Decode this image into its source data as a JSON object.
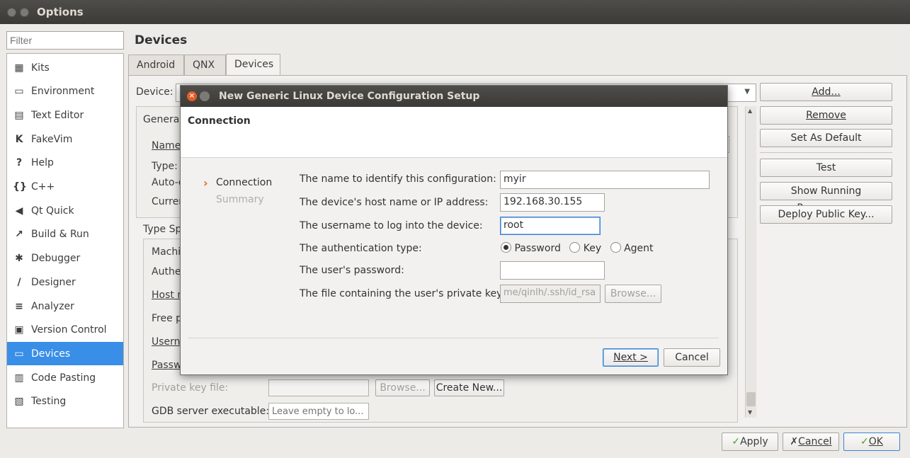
{
  "window": {
    "title": "Options"
  },
  "filter": {
    "placeholder": "Filter"
  },
  "nav": [
    {
      "label": "Kits",
      "icon": "monitor-icon"
    },
    {
      "label": "Environment",
      "icon": "display-icon"
    },
    {
      "label": "Text Editor",
      "icon": "text-editor-icon"
    },
    {
      "label": "FakeVim",
      "icon": "fakevim-icon"
    },
    {
      "label": "Help",
      "icon": "help-icon"
    },
    {
      "label": "C++",
      "icon": "braces-icon"
    },
    {
      "label": "Qt Quick",
      "icon": "qtquick-icon"
    },
    {
      "label": "Build & Run",
      "icon": "hammer-icon"
    },
    {
      "label": "Debugger",
      "icon": "bug-icon"
    },
    {
      "label": "Designer",
      "icon": "pen-icon"
    },
    {
      "label": "Analyzer",
      "icon": "analyzer-icon"
    },
    {
      "label": "Version Control",
      "icon": "vcs-icon"
    },
    {
      "label": "Devices",
      "icon": "device-icon",
      "selected": true
    },
    {
      "label": "Code Pasting",
      "icon": "clipboard-icon"
    },
    {
      "label": "Testing",
      "icon": "testing-icon"
    }
  ],
  "main": {
    "title": "Devices",
    "tabs": [
      "Android",
      "QNX",
      "Devices"
    ],
    "active_tab": "Devices",
    "device_label": "Device:",
    "general_label": "General",
    "name_label": "Name",
    "type_label": "Type:",
    "auto_label": "Auto-d",
    "current_label": "Curren",
    "type_specific_label": "Type Sp",
    "machine_label": "Machi",
    "auth_label": "Authe",
    "host_label": "Host n",
    "free_label": "Free p",
    "user_label": "Usern",
    "pass_label": "Passw",
    "private_key_label": "Private key file:",
    "browse_label": "Browse...",
    "create_new_label": "Create New...",
    "gdb_label": "GDB server executable:",
    "gdb_placeholder": "Leave empty to lo..."
  },
  "right_buttons": {
    "add": "Add...",
    "remove": "Remove",
    "set_default": "Set As Default",
    "test": "Test",
    "show_processes": "Show Running Processes...",
    "deploy_key": "Deploy Public Key..."
  },
  "bottom": {
    "apply": "Apply",
    "cancel": "Cancel",
    "ok": "OK"
  },
  "dialog": {
    "title": "New Generic Linux Device Configuration Setup",
    "header": "Connection",
    "steps": {
      "current": "Connection",
      "next": "Summary"
    },
    "fields": {
      "name_label": "The name to identify this configuration:",
      "name_value": "myir",
      "host_label": "The device's host name or IP address:",
      "host_value": "192.168.30.155",
      "user_label": "The username to log into the device:",
      "user_value": "root",
      "auth_label": "The authentication type:",
      "auth_options": [
        "Password",
        "Key",
        "Agent"
      ],
      "auth_selected": "Password",
      "password_label": "The user's password:",
      "password_value": "",
      "key_label": "The file containing the user's private key:",
      "key_value": "me/qinlh/.ssh/id_rsa",
      "browse_label": "Browse..."
    },
    "next_label": "Next >",
    "cancel_label": "Cancel"
  }
}
